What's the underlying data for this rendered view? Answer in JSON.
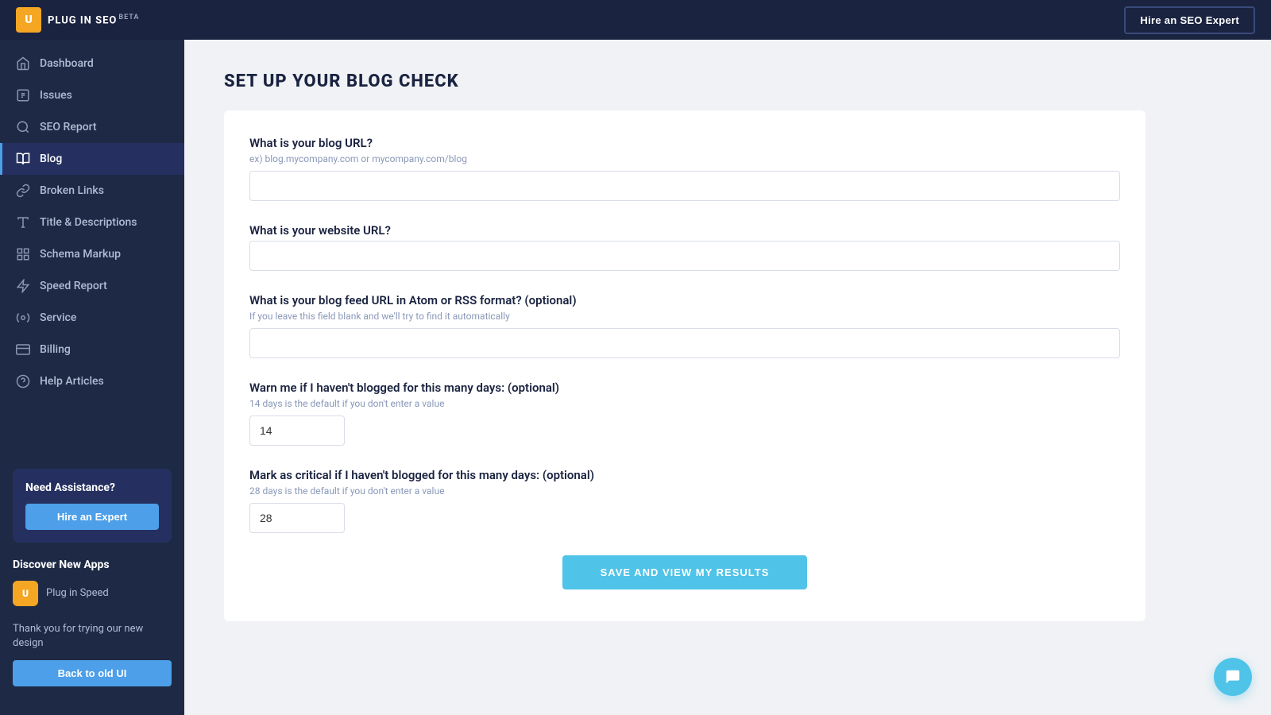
{
  "app": {
    "logo_letter": "U",
    "logo_text": "PLUG IN SEO",
    "logo_beta": "BETA",
    "hire_expert_nav_label": "Hire an SEO Expert"
  },
  "sidebar": {
    "items": [
      {
        "id": "dashboard",
        "label": "Dashboard",
        "icon": "home"
      },
      {
        "id": "issues",
        "label": "Issues",
        "icon": "issues"
      },
      {
        "id": "seo-report",
        "label": "SEO Report",
        "icon": "search"
      },
      {
        "id": "blog",
        "label": "Blog",
        "icon": "blog",
        "active": true
      },
      {
        "id": "broken-links",
        "label": "Broken Links",
        "icon": "link"
      },
      {
        "id": "title-descriptions",
        "label": "Title & Descriptions",
        "icon": "title"
      },
      {
        "id": "schema-markup",
        "label": "Schema Markup",
        "icon": "schema"
      },
      {
        "id": "speed-report",
        "label": "Speed Report",
        "icon": "speed"
      },
      {
        "id": "service",
        "label": "Service",
        "icon": "service"
      },
      {
        "id": "billing",
        "label": "Billing",
        "icon": "billing"
      },
      {
        "id": "help-articles",
        "label": "Help Articles",
        "icon": "help"
      }
    ],
    "assistance": {
      "title": "Need Assistance?",
      "hire_label": "Hire an Expert"
    },
    "discover": {
      "title": "Discover New Apps",
      "app_name": "Plug in Speed"
    },
    "thank_you": {
      "text": "Thank you for trying our new design",
      "back_label": "Back to old UI"
    }
  },
  "page": {
    "title": "SET UP YOUR BLOG CHECK",
    "form": {
      "blog_url_label": "What is your blog URL?",
      "blog_url_hint": "ex) blog.mycompany.com or mycompany.com/blog",
      "blog_url_value": "",
      "website_url_label": "What is your website URL?",
      "website_url_value": "",
      "feed_url_label": "What is your blog feed URL in Atom or RSS format? (optional)",
      "feed_url_hint": "If you leave this field blank and we'll try to find it automatically",
      "feed_url_value": "",
      "warn_label": "Warn me if I haven't blogged for this many days: (optional)",
      "warn_hint": "14 days is the default if you don't enter a value",
      "warn_value": "14",
      "critical_label": "Mark as critical if I haven't blogged for this many days: (optional)",
      "critical_hint": "28 days is the default if you don't enter a value",
      "critical_value": "28",
      "save_button_label": "SAVE AND VIEW MY RESULTS"
    }
  }
}
